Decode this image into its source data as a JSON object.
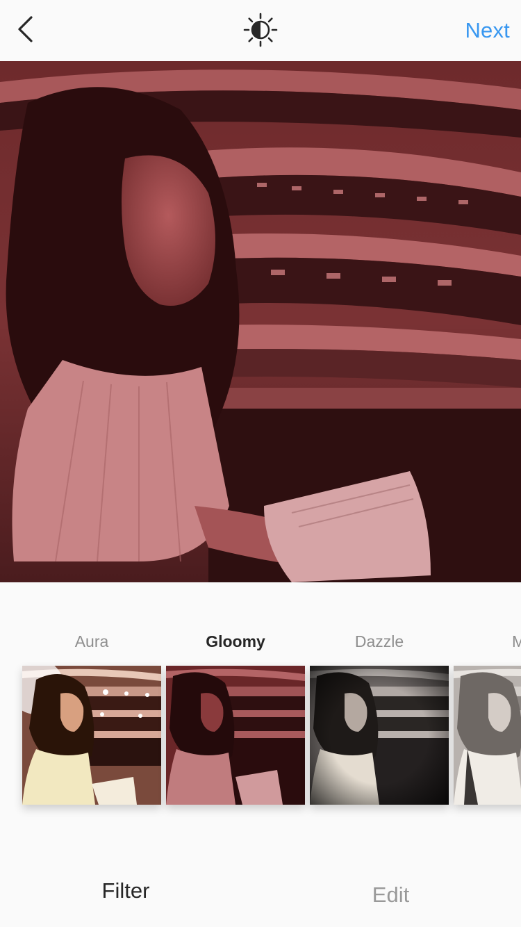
{
  "header": {
    "back_icon": "chevron-left-icon",
    "lux_icon": "lux-brightness-icon",
    "next_label": "Next",
    "accent_color": "#3897f0"
  },
  "photo": {
    "applied_filter": "Gloomy",
    "tint_color": "#a0474a"
  },
  "filters": [
    {
      "label": "Aura",
      "active": false
    },
    {
      "label": "Gloomy",
      "active": true
    },
    {
      "label": "Dazzle",
      "active": false
    },
    {
      "label": "Mo",
      "active": false
    }
  ],
  "tabs": {
    "filter_label": "Filter",
    "edit_label": "Edit",
    "active": "Filter"
  }
}
